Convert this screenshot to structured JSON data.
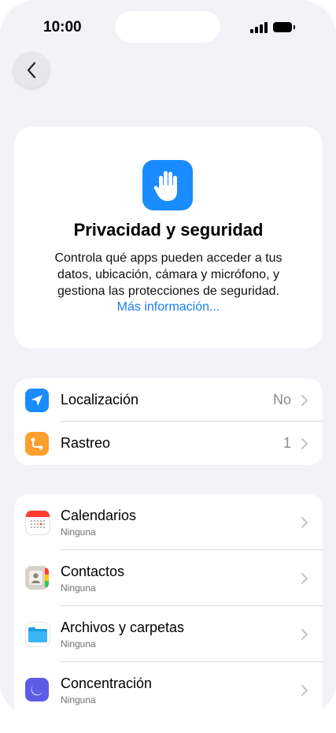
{
  "status": {
    "time": "10:00"
  },
  "hero": {
    "title": "Privacidad y seguridad",
    "description": "Controla qué apps pueden acceder a tus datos, ubicación, cámara y micrófono, y gestiona las protecciones de seguridad.",
    "link": "Más información..."
  },
  "group1": [
    {
      "label": "Localización",
      "value": "No"
    },
    {
      "label": "Rastreo",
      "value": "1"
    }
  ],
  "group2": [
    {
      "label": "Calendarios",
      "sub": "Ninguna"
    },
    {
      "label": "Contactos",
      "sub": "Ninguna"
    },
    {
      "label": "Archivos y carpetas",
      "sub": "Ninguna"
    },
    {
      "label": "Concentración",
      "sub": "Ninguna"
    }
  ],
  "colors": {
    "accent": "#1a7cf0",
    "location": "#1a8cff",
    "tracking": "#ff9f2e",
    "calendar": "#ff3b30",
    "files": "#20a4f3",
    "focus": "#5e5ce6"
  }
}
